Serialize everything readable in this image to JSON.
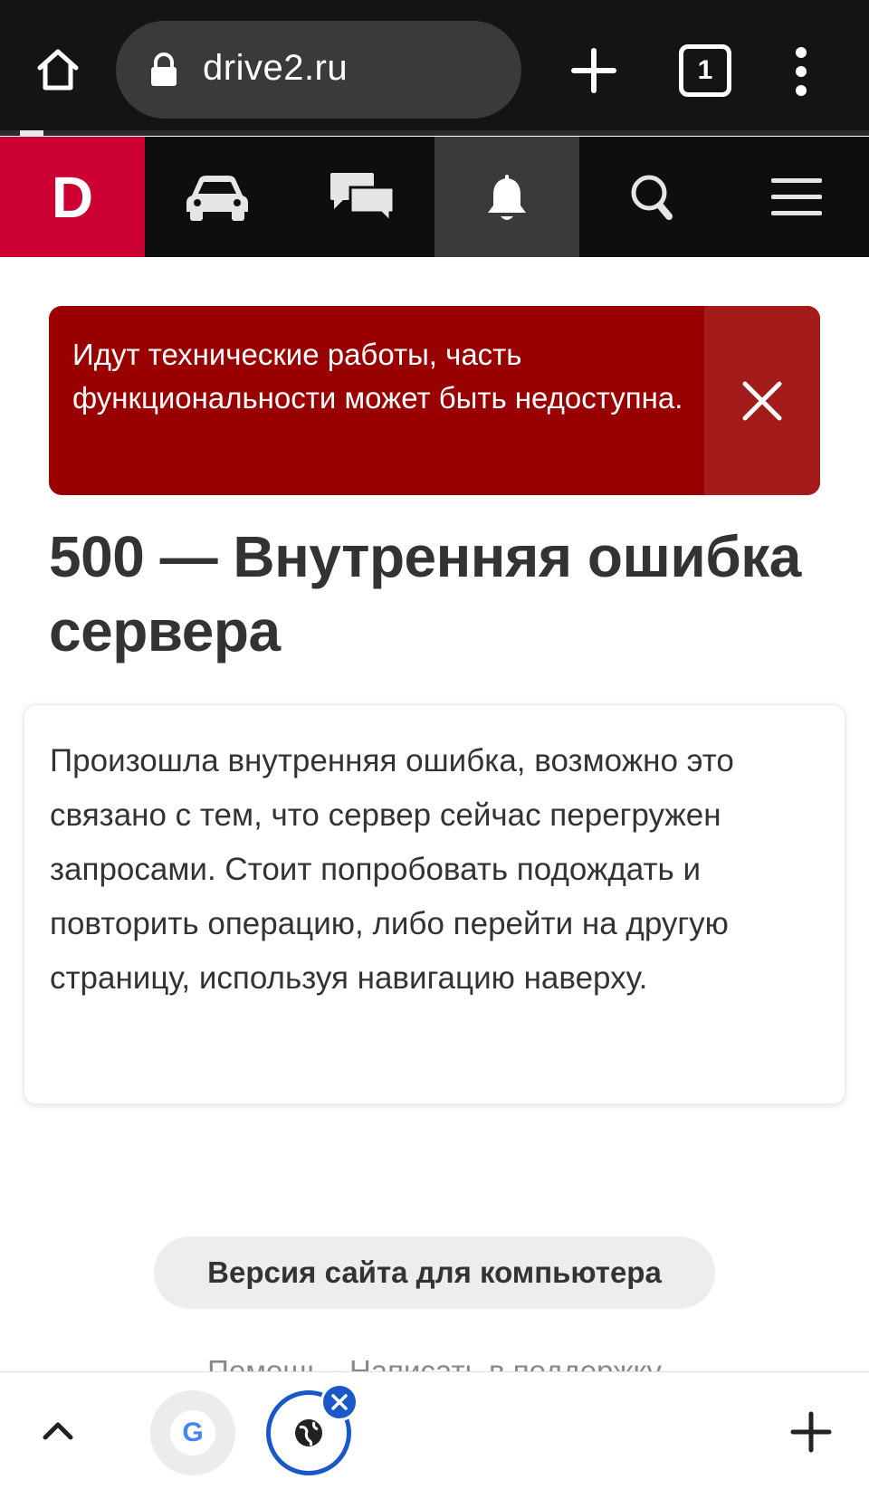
{
  "browser": {
    "url": "drive2.ru",
    "tab_count": "1",
    "load_progress": 0.05
  },
  "nav": {
    "logo": "D",
    "items": [
      "car-icon",
      "chat-icon",
      "bell-icon",
      "search-icon",
      "hamburger-menu-icon"
    ]
  },
  "alert": {
    "text": "Идут технические работы, часть функциональности может быть недоступна."
  },
  "error": {
    "title": "500 — Внутренняя ошибка сервера",
    "message": "Произошла внутренняя ошибка, возможно это связано с тем, что сервер сейчас перегружен запросами. Стоит попробовать подождать и повторить операцию, либо перейти на другую страницу, используя навигацию наверху."
  },
  "desktop_version": {
    "label": "Версия сайта для компьютера"
  },
  "footer": {
    "links_text": "Помощь · Написать в поддержку"
  },
  "bottom_bar": {
    "google_tab_letter": "G"
  },
  "colors": {
    "brand_red": "#cc0033",
    "alert_bg": "#990000",
    "tab_blue": "#1a57c9"
  }
}
